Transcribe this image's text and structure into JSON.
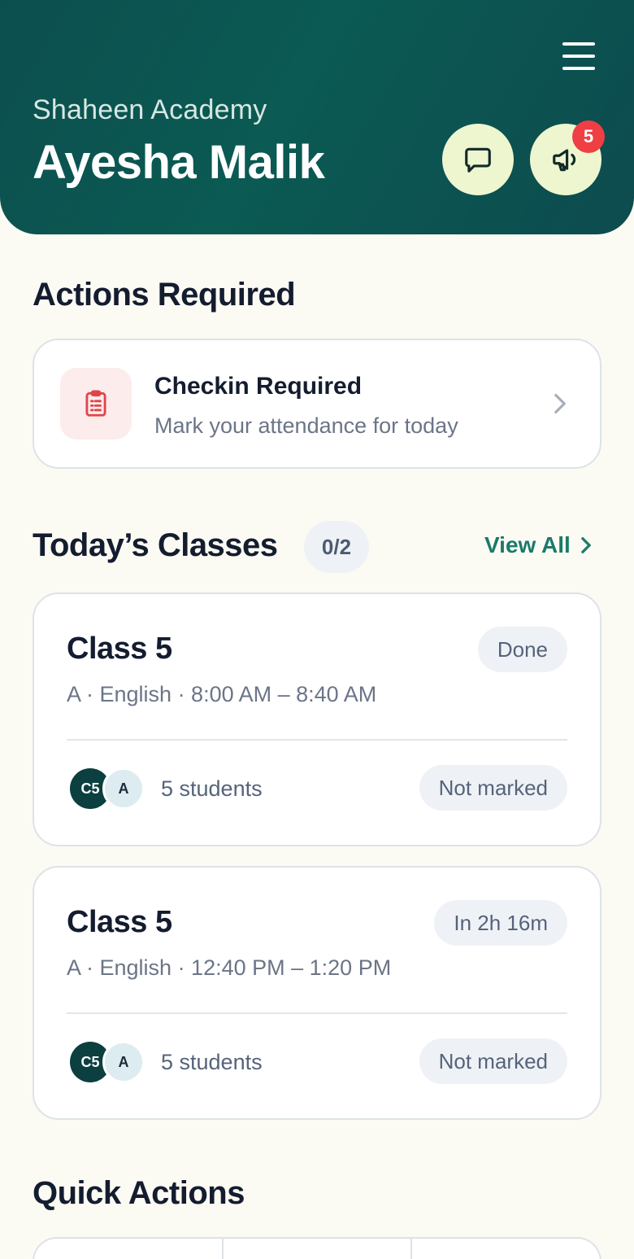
{
  "header": {
    "org_name": "Shaheen Academy",
    "user_name": "Ayesha Malik",
    "announcement_badge": "5"
  },
  "actions": {
    "title": "Actions Required",
    "items": [
      {
        "title": "Checkin Required",
        "subtitle": "Mark your attendance for today"
      }
    ]
  },
  "classes": {
    "title": "Today’s Classes",
    "count": "0/2",
    "view_all": "View All",
    "items": [
      {
        "name": "Class 5",
        "meta": "A · English · 8:00 AM – 8:40 AM",
        "status": "Done",
        "avatar_primary": "C5",
        "avatar_secondary": "A",
        "students": "5 students",
        "marking": "Not marked"
      },
      {
        "name": "Class 5",
        "meta": "A · English · 12:40 PM – 1:20 PM",
        "status": "In 2h 16m",
        "avatar_primary": "C5",
        "avatar_secondary": "A",
        "students": "5 students",
        "marking": "Not marked"
      }
    ]
  },
  "quick_actions": {
    "title": "Quick Actions"
  },
  "colors": {
    "header_bg": "#0c4f4f",
    "accent": "#1a7a6a",
    "badge": "#ef3f44",
    "round_button_bg": "#eef6cf",
    "page_bg": "#fbfbf3"
  },
  "icons": {
    "menu": "hamburger-menu-icon",
    "messages": "chat-bubble-icon",
    "announcements": "megaphone-icon",
    "checkin": "clipboard-icon",
    "chevron": "chevron-right-icon"
  }
}
